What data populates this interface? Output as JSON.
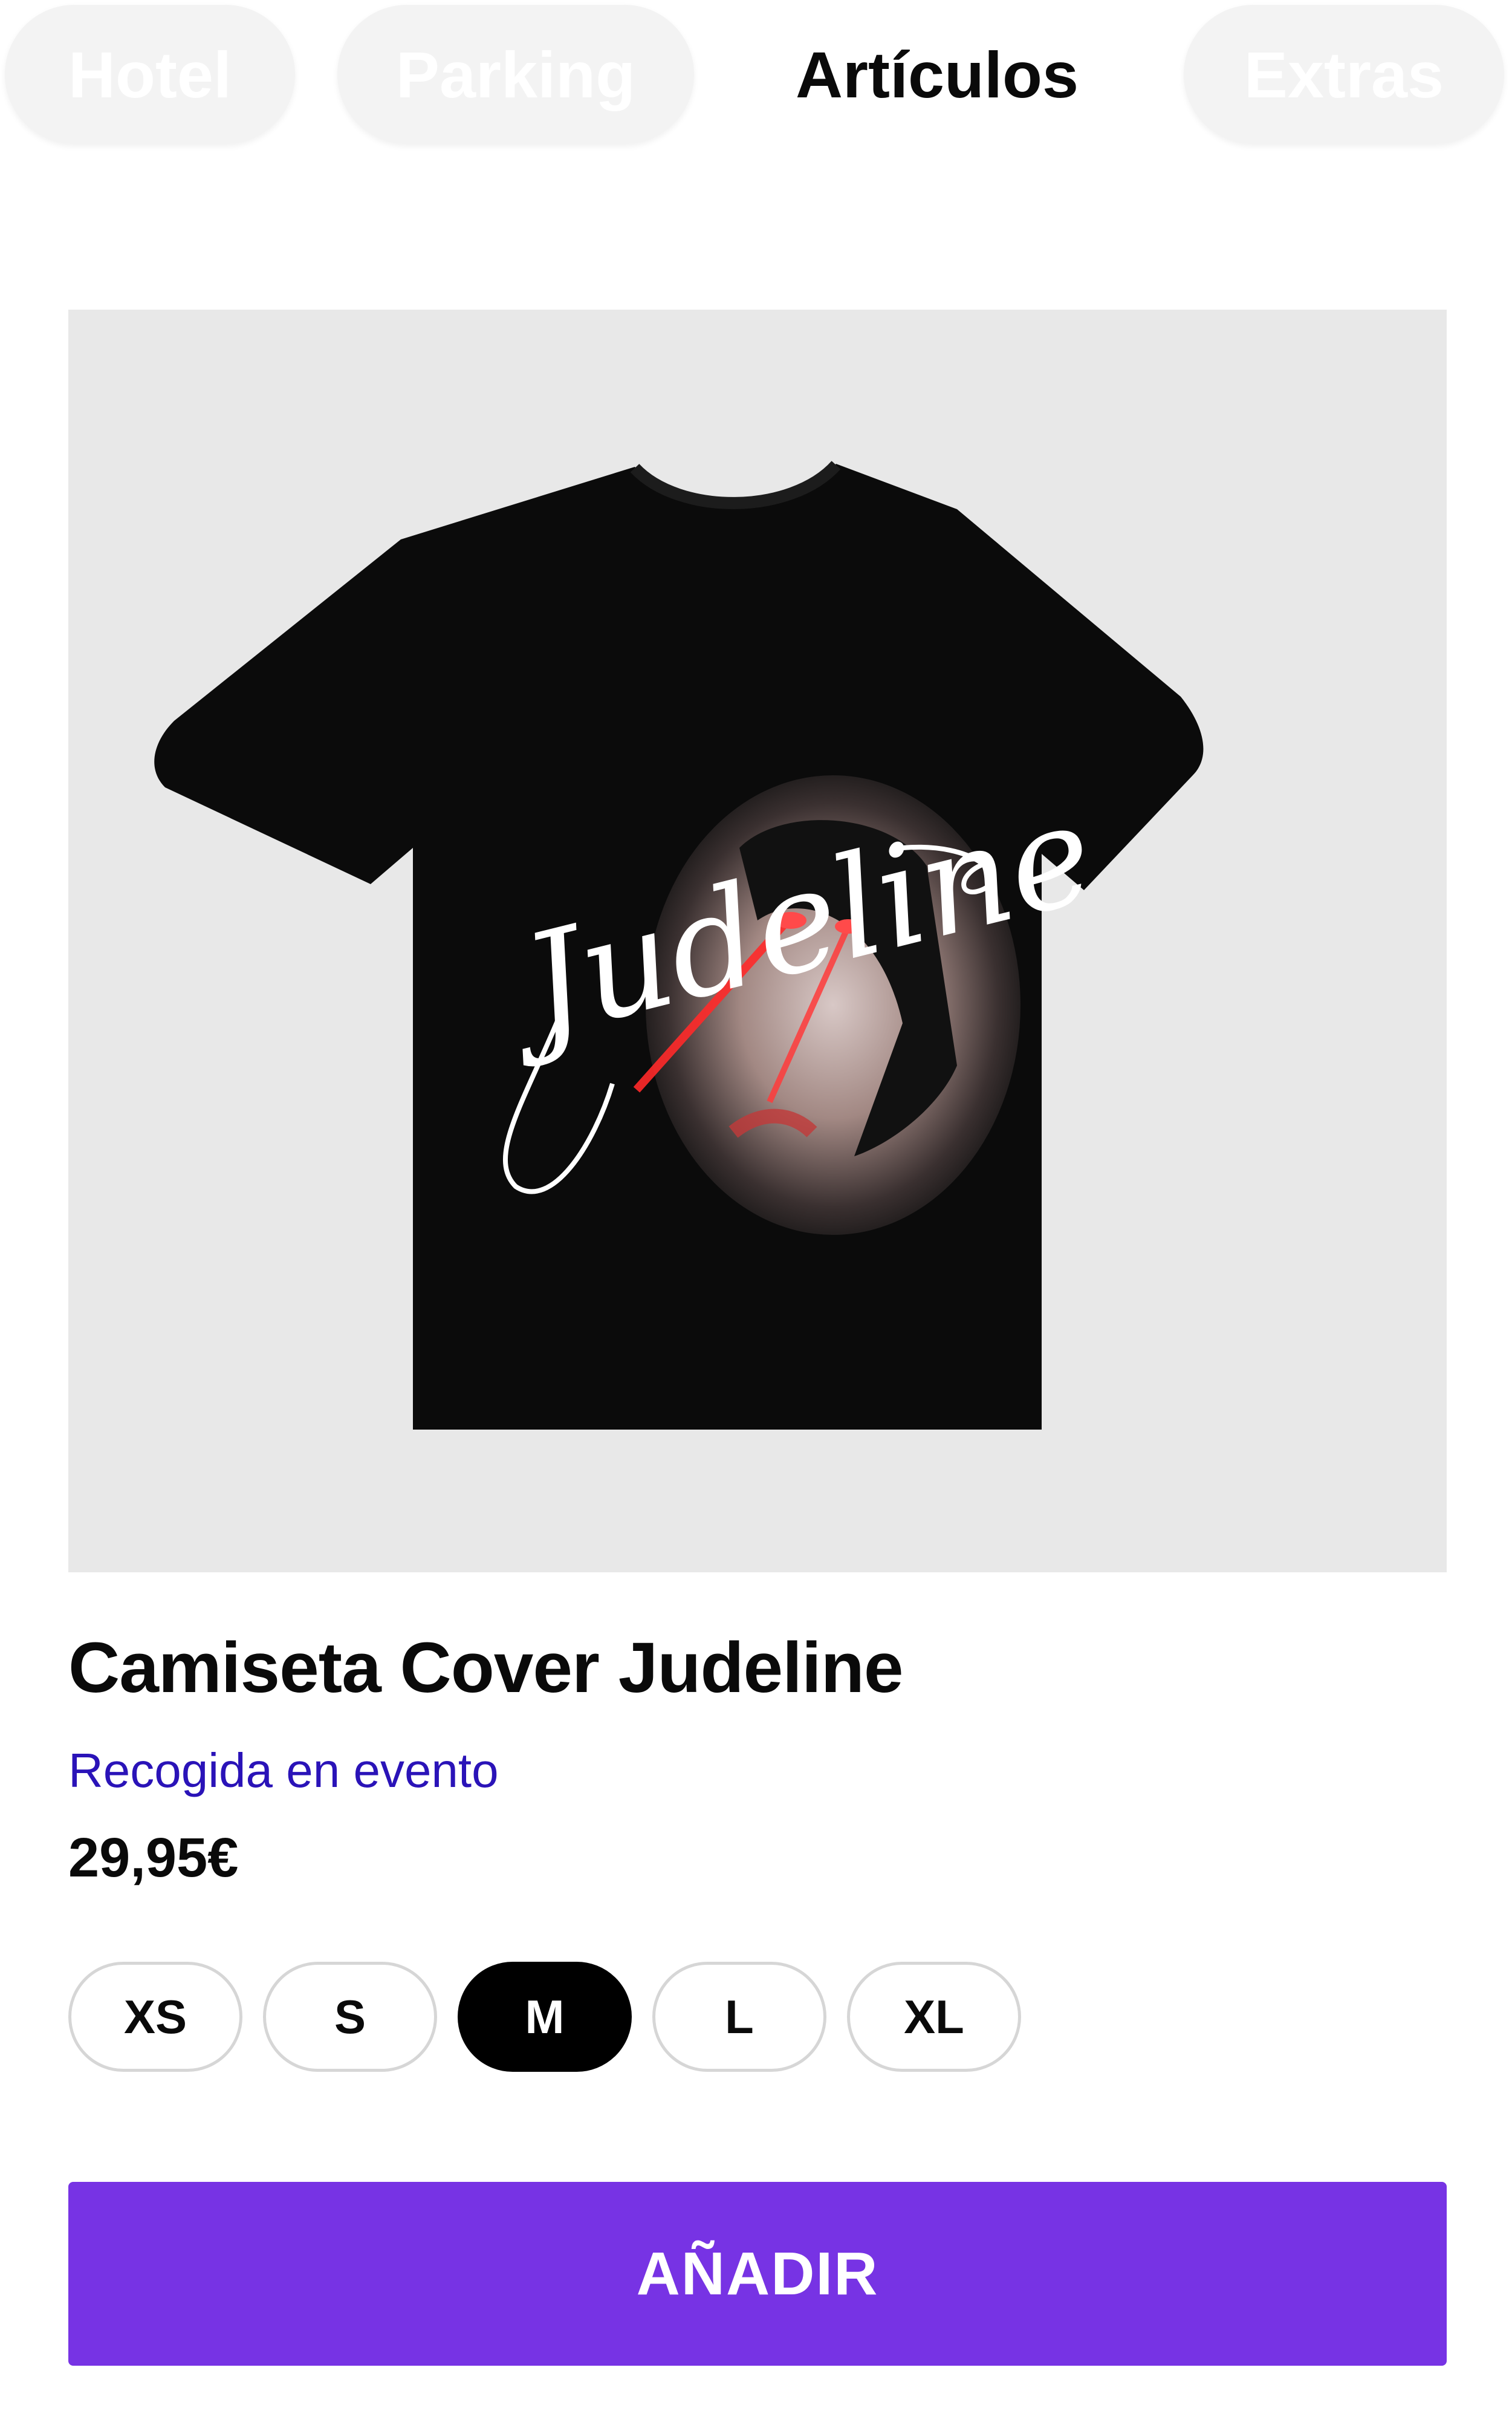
{
  "tabs": [
    {
      "label": "Hotel",
      "active": false
    },
    {
      "label": "Parking",
      "active": false
    },
    {
      "label": "Artículos",
      "active": true
    },
    {
      "label": "Extras",
      "active": false
    }
  ],
  "product": {
    "image_text": "Judeline",
    "title": "Camiseta Cover Judeline",
    "pickup": "Recogida en evento",
    "price": "29,95€",
    "sizes": [
      "XS",
      "S",
      "M",
      "L",
      "XL"
    ],
    "selected_size": "M",
    "add_label": "AÑADIR"
  },
  "colors": {
    "accent": "#7733e4",
    "link": "#2a13b8",
    "image_background": "#e8e8e8"
  }
}
